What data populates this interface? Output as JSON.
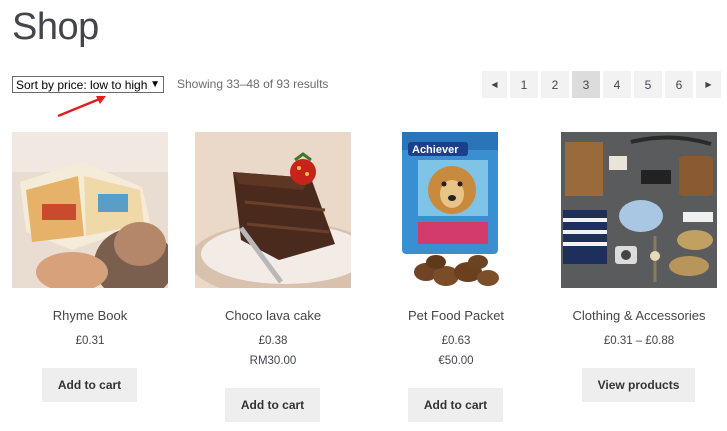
{
  "page": {
    "title": "Shop"
  },
  "toolbar": {
    "sort_value": "Sort by price: low to high",
    "result_count": "Showing 33–48 of 93 results"
  },
  "pagination": {
    "pages": [
      "1",
      "2",
      "3",
      "4",
      "5",
      "6"
    ],
    "current": "3",
    "prev_icon": "triangle-left-icon",
    "next_icon": "triangle-right-icon"
  },
  "annotation": {
    "color": "#e02020"
  },
  "products": [
    {
      "name": "Rhyme Book",
      "price": "£0.31",
      "price_alt": "",
      "button": "Add to cart"
    },
    {
      "name": "Choco lava cake",
      "price": "£0.38",
      "price_alt": "RM30.00",
      "button": "Add to cart"
    },
    {
      "name": "Pet Food Packet",
      "price": "£0.63",
      "price_alt": "€50.00",
      "button": "Add to cart",
      "package_text": "Achiever"
    },
    {
      "name": "Clothing & Accessories",
      "price": "£0.31 – £0.88",
      "price_alt": "",
      "button": "View products"
    }
  ]
}
